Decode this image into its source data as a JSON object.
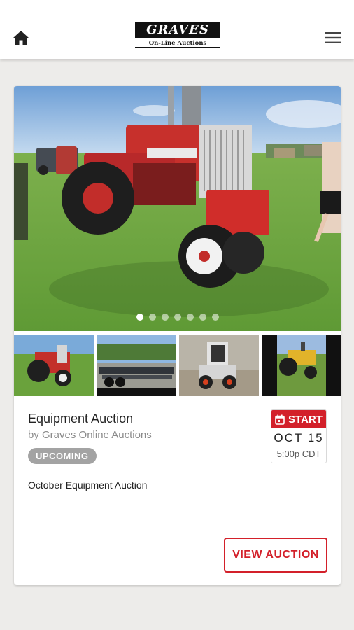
{
  "header": {
    "home_icon": "home-icon",
    "menu_icon": "hamburger-menu-icon",
    "logo": {
      "main": "GRAVES",
      "sub": "On-Line Auctions"
    }
  },
  "gallery": {
    "slide_count": 7,
    "active_slide": 1,
    "thumbnails": [
      "red-tractor-thumb",
      "flatbed-trailers-thumb",
      "skid-steer-thumb",
      "yellow-tractor-thumb"
    ]
  },
  "auction": {
    "title": "Equipment Auction",
    "seller": "by Graves Online Auctions",
    "status": "UPCOMING",
    "description": "October Equipment Auction",
    "start_label": "START",
    "start_date": "OCT 15",
    "start_time": "5:00p CDT",
    "view_button": "VIEW AUCTION"
  },
  "colors": {
    "accent": "#d3202a",
    "badge": "#a3a3a3",
    "background": "#edecea"
  }
}
